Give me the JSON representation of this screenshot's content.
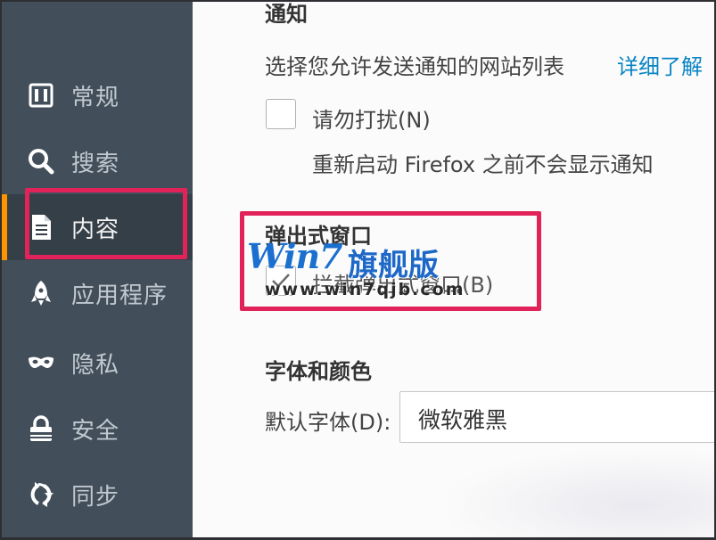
{
  "sidebar": {
    "items": [
      {
        "label": "常规",
        "icon": "general-icon"
      },
      {
        "label": "搜索",
        "icon": "search-icon"
      },
      {
        "label": "内容",
        "icon": "document-icon",
        "selected": true
      },
      {
        "label": "应用程序",
        "icon": "rocket-icon"
      },
      {
        "label": "隐私",
        "icon": "mask-icon"
      },
      {
        "label": "安全",
        "icon": "lock-icon"
      },
      {
        "label": "同步",
        "icon": "sync-icon"
      }
    ]
  },
  "notifications": {
    "heading": "通知",
    "description": "选择您允许发送通知的网站列表",
    "learn_more": "详细了解",
    "dnd_label": "请勿打扰(N)",
    "dnd_checked": false,
    "dnd_hint": "重新启动 Firefox 之前不会显示通知"
  },
  "popups": {
    "heading": "弹出式窗口",
    "block_label": "拦截弹出式窗口(B)",
    "block_checked": true
  },
  "fonts": {
    "heading": "字体和颜色",
    "default_font_label": "默认字体(D):",
    "default_font_value": "微软雅黑"
  },
  "watermark": {
    "logo": "Win7",
    "logo_cn": "旗舰版",
    "url": "www.win7qjb.com"
  },
  "colors": {
    "sidebar_bg": "#424f5a",
    "sidebar_selected_bg": "#343f48",
    "selected_accent": "#ff9400",
    "highlight_box": "#e1235a",
    "link": "#0a84c4"
  }
}
